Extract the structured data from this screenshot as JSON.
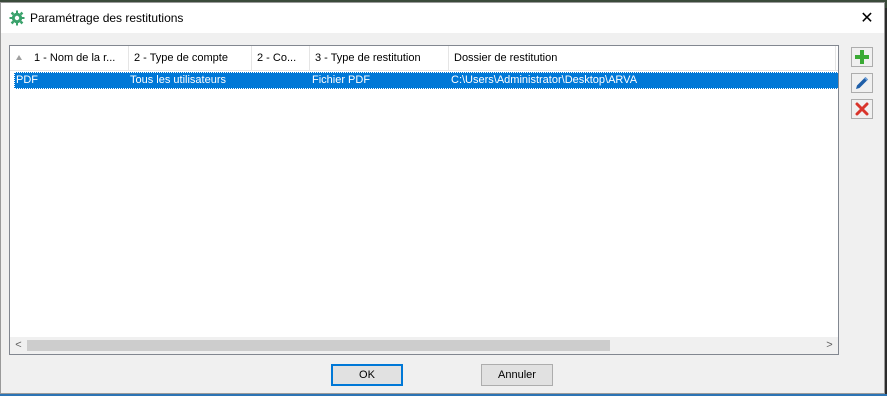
{
  "window": {
    "title": "Paramétrage des restitutions",
    "close_glyph": "✕"
  },
  "list": {
    "columns": [
      {
        "label": "1 - Nom de la r..."
      },
      {
        "label": "2 - Type de compte"
      },
      {
        "label": "2 - Co..."
      },
      {
        "label": "3 - Type de restitution"
      },
      {
        "label": "Dossier de restitution"
      }
    ],
    "rows": [
      {
        "cells": [
          "PDF",
          "Tous les utilisateurs",
          "",
          "Fichier PDF",
          "C:\\Users\\Administrator\\Desktop\\ARVA"
        ],
        "selected": true
      }
    ],
    "scroll_left_glyph": "<",
    "scroll_right_glyph": ">"
  },
  "side_buttons": [
    {
      "icon": "plus-icon",
      "color": "#3aaa35"
    },
    {
      "icon": "pencil-icon",
      "color": "#1f5fa8"
    },
    {
      "icon": "delete-x-icon",
      "color": "#d9342b"
    }
  ],
  "buttons": {
    "ok": "OK",
    "cancel": "Annuler"
  },
  "colors": {
    "selection": "#0078d7",
    "accent": "#0078d7"
  }
}
